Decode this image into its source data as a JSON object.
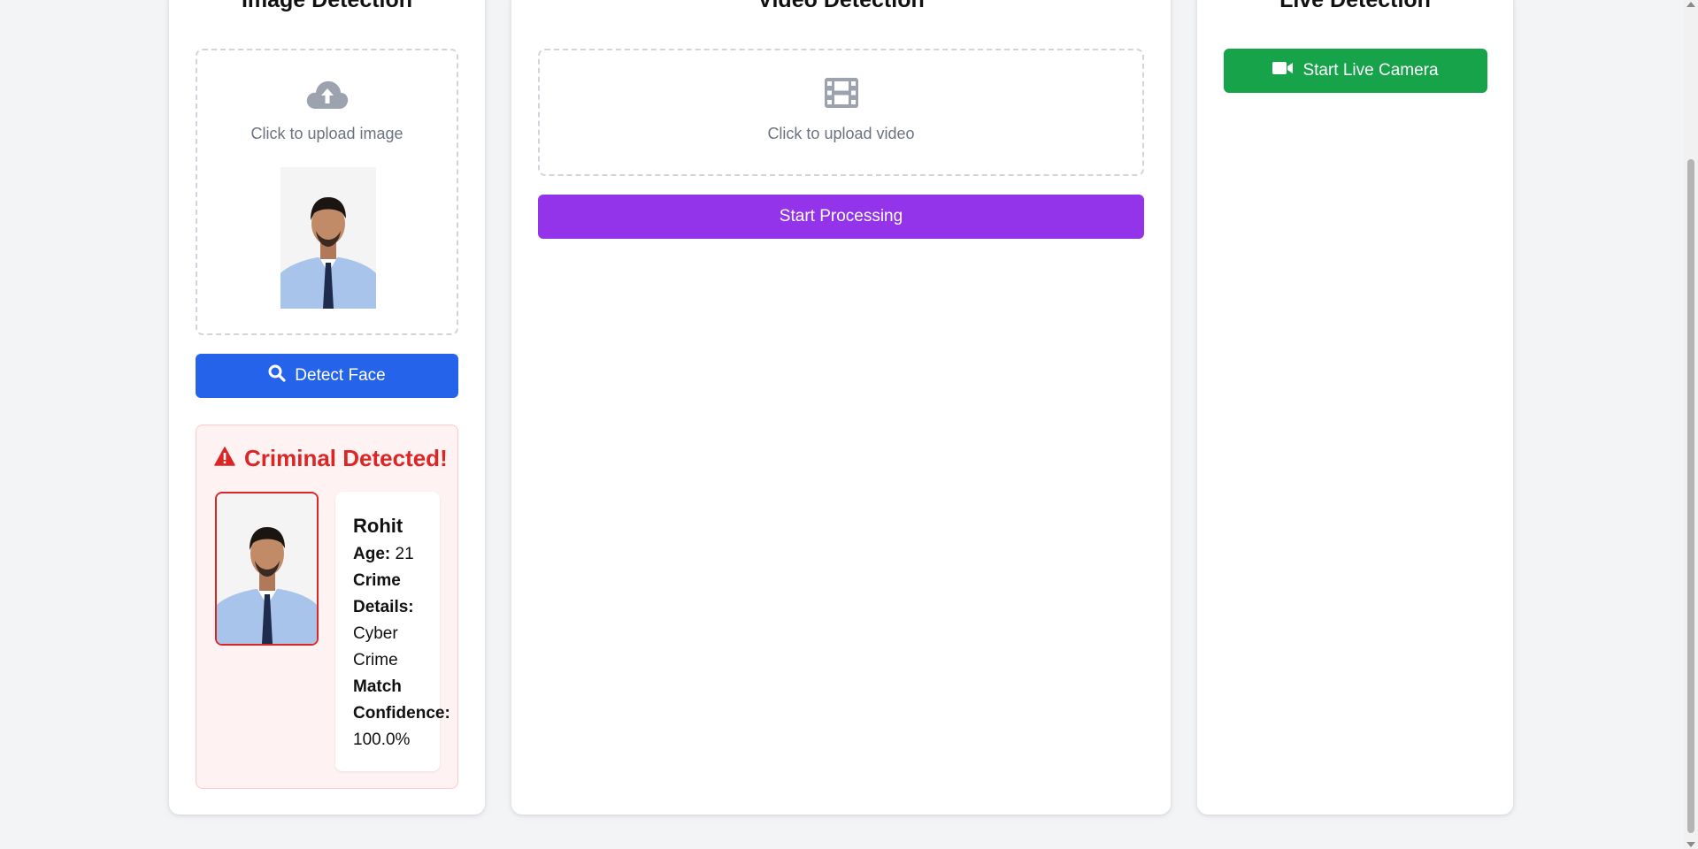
{
  "image_panel": {
    "title": "Image Detection",
    "upload_text": "Click to upload image",
    "upload_icon": "cloud-upload-icon",
    "detect_button": "Detect Face",
    "detect_icon": "search-icon"
  },
  "result": {
    "heading": "Criminal Detected!",
    "heading_icon": "warning-triangle-icon",
    "name": "Rohit",
    "age_label": "Age:",
    "age": "21",
    "crime_label_1": "Crime",
    "crime_label_2": "Details:",
    "crime_value_1": "Cyber",
    "crime_value_2": "Crime",
    "confidence_label_1": "Match",
    "confidence_label_2": "Confidence:",
    "confidence_value": "100.0%"
  },
  "video_panel": {
    "title": "Video Detection",
    "upload_text": "Click to upload video",
    "upload_icon": "film-icon",
    "process_button": "Start Processing"
  },
  "live_panel": {
    "title": "Live Detection",
    "camera_button": "Start Live Camera",
    "camera_icon": "video-camera-icon"
  },
  "colors": {
    "detect_button": "#2563eb",
    "process_button": "#9333ea",
    "camera_button": "#16a34a",
    "alert_text": "#dc2626",
    "alert_bg": "#fef2f2"
  }
}
